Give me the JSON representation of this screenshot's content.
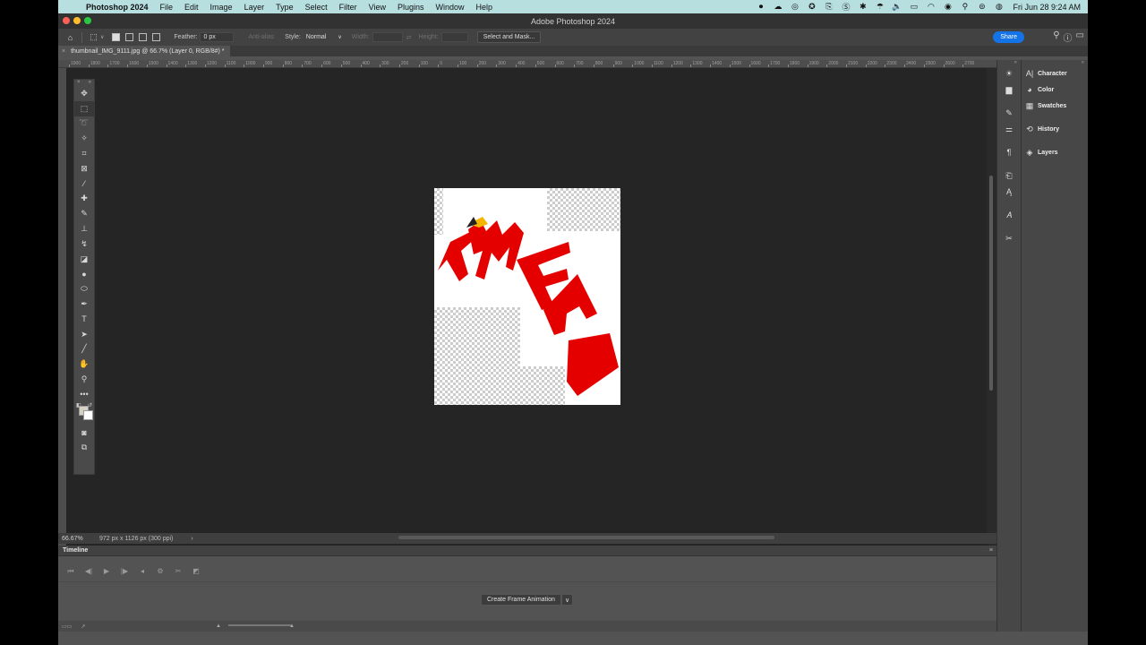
{
  "menubar": {
    "app_name": "Photoshop 2024",
    "items": [
      "File",
      "Edit",
      "Image",
      "Layer",
      "Type",
      "Select",
      "Filter",
      "View",
      "Plugins",
      "Window",
      "Help"
    ],
    "clock": "Fri Jun 28  9:24 AM"
  },
  "window": {
    "title": "Adobe Photoshop 2024"
  },
  "options_bar": {
    "feather_label": "Feather:",
    "feather_value": "0 px",
    "anti_alias_label": "Anti-alias",
    "style_label": "Style:",
    "style_value": "Normal",
    "width_label": "Width:",
    "height_label": "Height:",
    "select_mask_label": "Select and Mask...",
    "share_label": "Share"
  },
  "document": {
    "tab_title": "thumbnail_IMG_9111.jpg @ 66.7% (Layer 0, RGB/8#) *"
  },
  "ruler": {
    "labels": [
      "1900",
      "1800",
      "1700",
      "1600",
      "1500",
      "1400",
      "1300",
      "1200",
      "1100",
      "1000",
      "900",
      "800",
      "700",
      "600",
      "500",
      "400",
      "300",
      "200",
      "100",
      "0",
      "100",
      "200",
      "300",
      "400",
      "500",
      "600",
      "700",
      "800",
      "900",
      "1000",
      "1100",
      "1200",
      "1300",
      "1400",
      "1500",
      "1600",
      "1700",
      "1800",
      "1900",
      "2000",
      "2100",
      "2200",
      "2300",
      "2400",
      "2500",
      "2600",
      "2700"
    ]
  },
  "toolbar": {
    "tools": [
      {
        "name": "move-tool",
        "glyph": "✥"
      },
      {
        "name": "rectangular-marquee-tool",
        "glyph": "⬚"
      },
      {
        "name": "lasso-tool",
        "glyph": "➰"
      },
      {
        "name": "magic-wand-tool",
        "glyph": "✧"
      },
      {
        "name": "crop-tool",
        "glyph": "⌗"
      },
      {
        "name": "frame-tool",
        "glyph": "⊠"
      },
      {
        "name": "eyedropper-tool",
        "glyph": "⁄"
      },
      {
        "name": "spot-healing-tool",
        "glyph": "✚"
      },
      {
        "name": "brush-tool",
        "glyph": "✎"
      },
      {
        "name": "clone-stamp-tool",
        "glyph": "⊥"
      },
      {
        "name": "history-brush-tool",
        "glyph": "↯"
      },
      {
        "name": "eraser-tool",
        "glyph": "◪"
      },
      {
        "name": "gradient-tool",
        "glyph": "●"
      },
      {
        "name": "dodge-tool",
        "glyph": "⬭"
      },
      {
        "name": "pen-tool",
        "glyph": "✒"
      },
      {
        "name": "type-tool",
        "glyph": "T"
      },
      {
        "name": "path-selection-tool",
        "glyph": "➤"
      },
      {
        "name": "line-tool",
        "glyph": "╱"
      },
      {
        "name": "hand-tool",
        "glyph": "✋"
      },
      {
        "name": "zoom-tool",
        "glyph": "⚲"
      },
      {
        "name": "edit-toolbar",
        "glyph": "•••"
      }
    ]
  },
  "status_bar": {
    "zoom": "66.67%",
    "doc_info": "972 px x 1126 px (300 ppi)",
    "arrow": "›"
  },
  "timeline": {
    "title": "Timeline",
    "create_label": "Create Frame Animation",
    "dropdown": "∨"
  },
  "panels": [
    {
      "name": "character",
      "label": "Character",
      "glyph": "A|"
    },
    {
      "name": "color",
      "label": "Color",
      "glyph": "◕"
    },
    {
      "name": "swatches",
      "label": "Swatches",
      "glyph": "▦"
    },
    {
      "name": "history",
      "label": "History",
      "glyph": "⟲"
    },
    {
      "name": "layers",
      "label": "Layers",
      "glyph": "◈"
    }
  ],
  "colors": {
    "artwork_red": "#e50000",
    "share_blue": "#1473e6",
    "menubar_bg": "#b8dfe0"
  }
}
